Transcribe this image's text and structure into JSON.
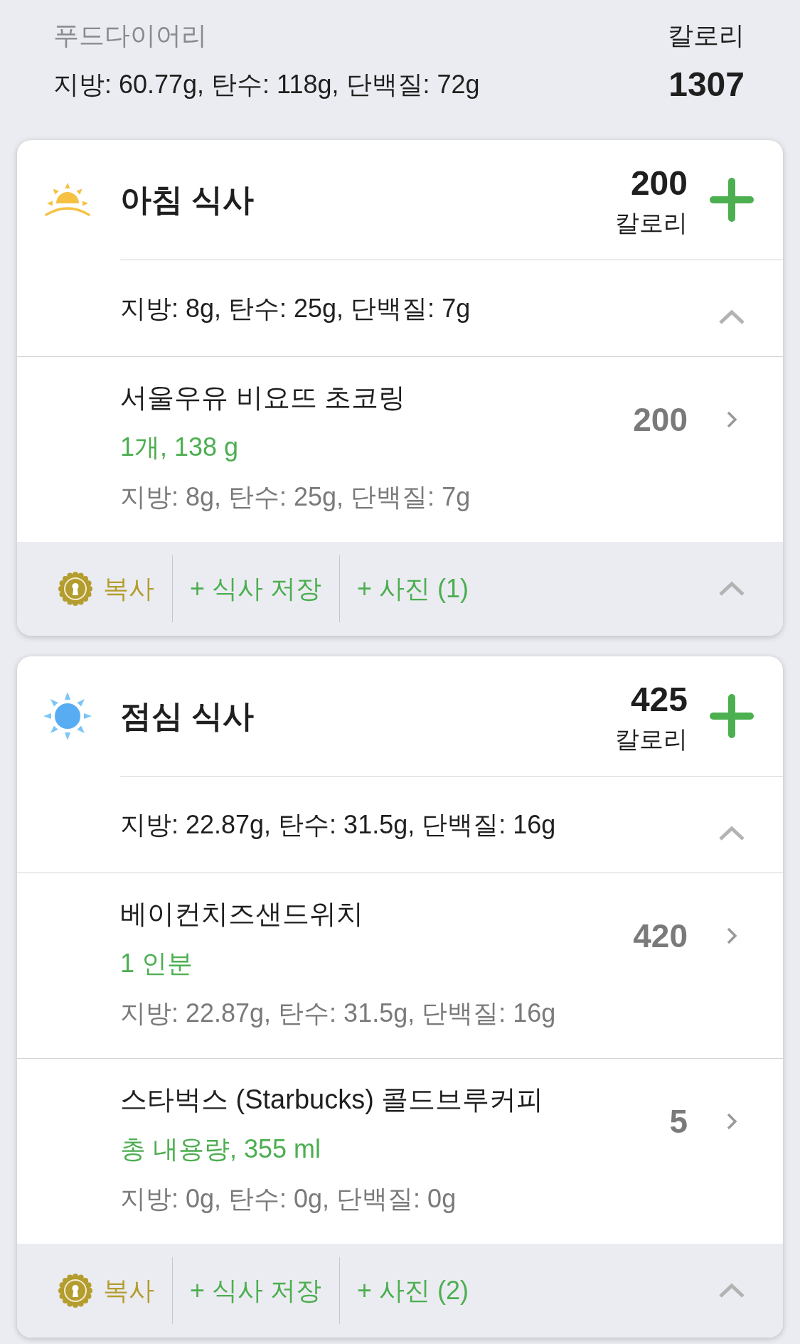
{
  "header": {
    "title": "푸드다이어리",
    "calories_label": "칼로리",
    "macros": "지방: 60.77g, 탄수: 118g, 단백질: 72g",
    "calories": "1307"
  },
  "meals": [
    {
      "kind": "breakfast",
      "title": "아침 식사",
      "calories": "200",
      "calories_label": "칼로리",
      "macros": "지방: 8g, 탄수: 25g, 단백질: 7g",
      "expanded": true,
      "items": [
        {
          "name": "서울우유 비요뜨 초코링",
          "serving": "1개, 138 g",
          "macros": "지방: 8g, 탄수: 25g, 단백질: 7g",
          "calories": "200"
        }
      ],
      "actions": [
        {
          "kind": "copy",
          "label": "복사"
        },
        {
          "kind": "save",
          "label": "+ 식사 저장"
        },
        {
          "kind": "photo",
          "label": "+ 사진 (1)"
        }
      ]
    },
    {
      "kind": "lunch",
      "title": "점심 식사",
      "calories": "425",
      "calories_label": "칼로리",
      "macros": "지방: 22.87g, 탄수: 31.5g, 단백질: 16g",
      "expanded": true,
      "items": [
        {
          "name": "베이컨치즈샌드위치",
          "serving": "1 인분",
          "macros": "지방: 22.87g, 탄수: 31.5g, 단백질: 16g",
          "calories": "420"
        },
        {
          "name": "스타벅스 (Starbucks) 콜드브루커피",
          "serving": "총 내용량, 355 ml",
          "macros": "지방: 0g, 탄수: 0g, 단백질: 0g",
          "calories": "5"
        }
      ],
      "actions": [
        {
          "kind": "copy",
          "label": "복사"
        },
        {
          "kind": "save",
          "label": "+ 식사 저장"
        },
        {
          "kind": "photo",
          "label": "+ 사진 (2)"
        }
      ]
    }
  ]
}
